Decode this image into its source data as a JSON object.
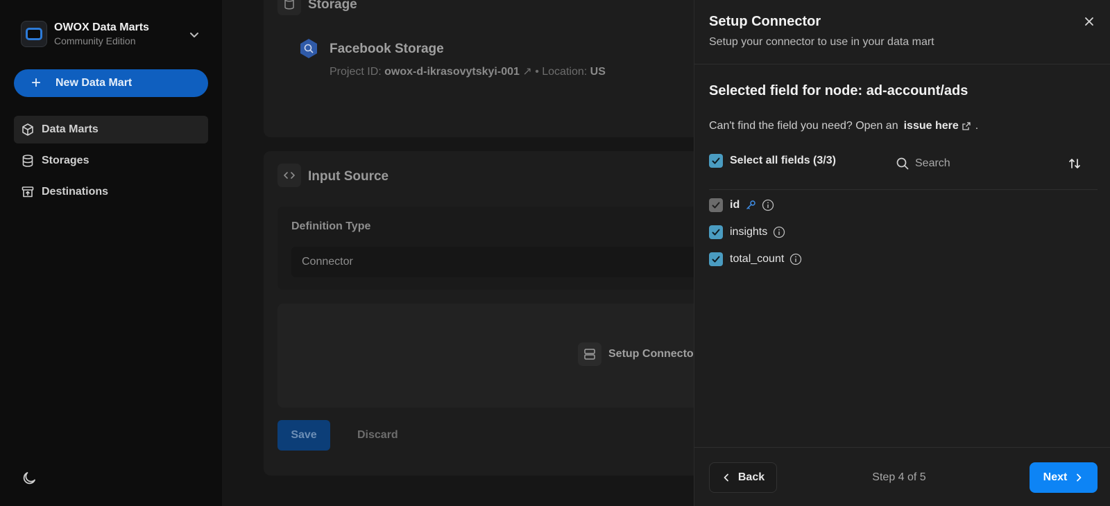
{
  "sidebar": {
    "brand_title": "OWOX Data Marts",
    "brand_subtitle": "Community Edition",
    "new_button": "New Data Mart",
    "items": [
      {
        "label": "Data Marts",
        "icon": "cube-icon",
        "active": true
      },
      {
        "label": "Storages",
        "icon": "database-icon",
        "active": false
      },
      {
        "label": "Destinations",
        "icon": "archive-icon",
        "active": false
      }
    ]
  },
  "main": {
    "storage_section": "Storage",
    "storage_name": "Facebook Storage",
    "project_label": "Project ID:",
    "project_id": "owox-d-ikrasovytskyi-001",
    "location_label": "Location:",
    "location": "US",
    "input_section": "Input Source",
    "definition_label": "Definition Type",
    "definition_value": "Connector",
    "setup_label": "Setup Connector",
    "save": "Save",
    "discard": "Discard"
  },
  "panel": {
    "title": "Setup Connector",
    "subtitle": "Setup your connector to use in your data mart",
    "node_title": "Selected field for node: ad-account/ads",
    "help_text": "Can't find the field you need? Open an",
    "help_link": "issue here",
    "help_end": ".",
    "select_all": "Select all fields (3/3)",
    "search_placeholder": "Search",
    "fields": [
      {
        "name": "id",
        "checked": true,
        "primary_key": true
      },
      {
        "name": "insights",
        "checked": true
      },
      {
        "name": "total_count",
        "checked": true
      }
    ],
    "back": "Back",
    "step": "Step 4 of 5",
    "next": "Next"
  },
  "colors": {
    "accent": "#0d84f5",
    "checkbox": "#4a9cc1",
    "new_button": "#0f5fbf"
  }
}
